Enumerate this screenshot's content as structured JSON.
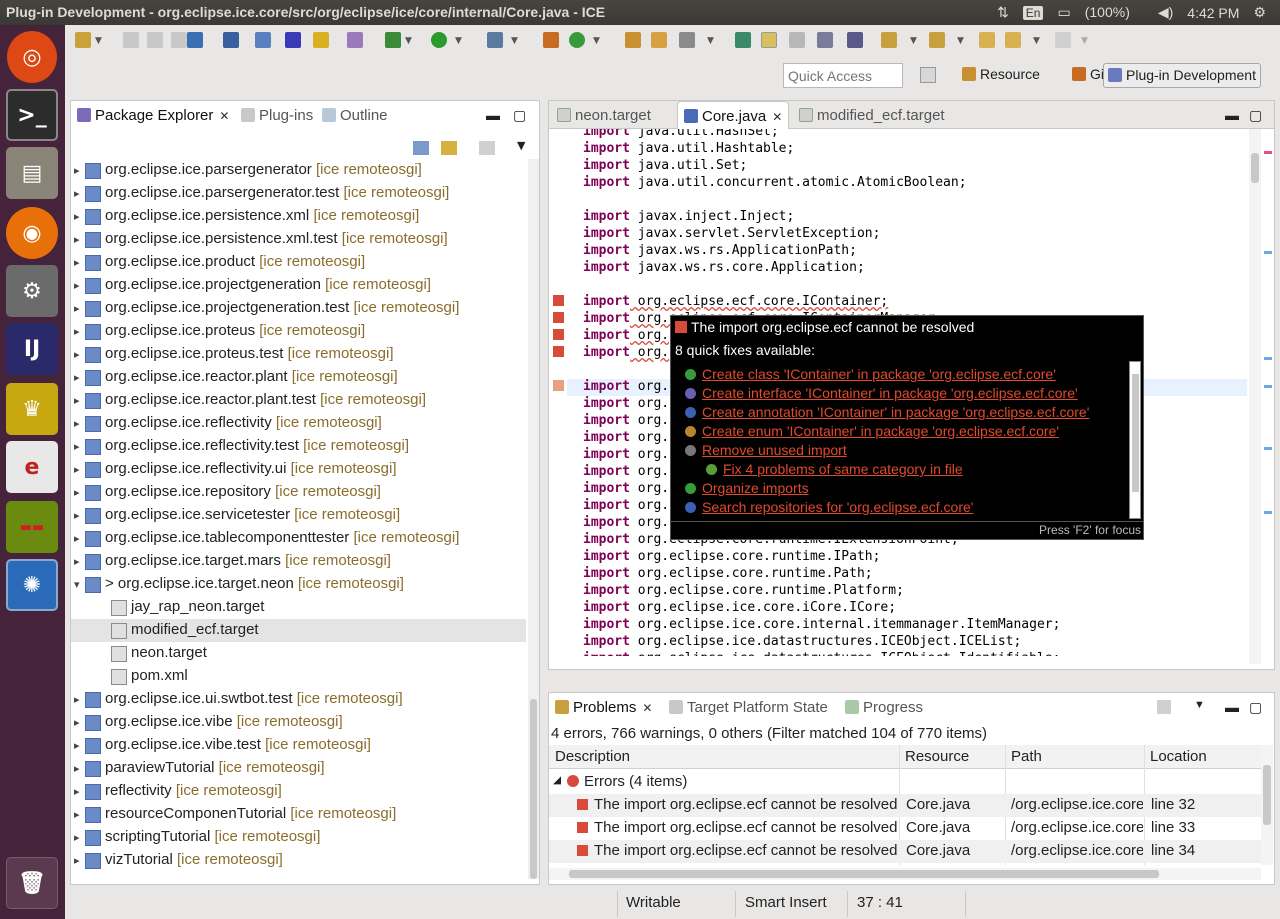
{
  "window": {
    "title": "Plug-in Development - org.eclipse.ice.core/src/org/eclipse/ice/core/internal/Core.java - ICE"
  },
  "tray": {
    "keyboard": "En",
    "battery": "(100%)",
    "clock": "4:42 PM"
  },
  "quick_access": {
    "placeholder": "Quick Access"
  },
  "perspectives": {
    "resource": "Resource",
    "git": "Git",
    "plugin": "Plug-in Development"
  },
  "package_explorer": {
    "tabs": [
      "Package Explorer",
      "Plug-ins",
      "Outline"
    ],
    "items": [
      {
        "name": "org.eclipse.ice.parsergenerator",
        "tag": "[ice remoteosgi]",
        "level": 0,
        "arrow": "▸"
      },
      {
        "name": "org.eclipse.ice.parsergenerator.test",
        "tag": "[ice remoteosgi]",
        "level": 0,
        "arrow": "▸"
      },
      {
        "name": "org.eclipse.ice.persistence.xml",
        "tag": "[ice remoteosgi]",
        "level": 0,
        "arrow": "▸"
      },
      {
        "name": "org.eclipse.ice.persistence.xml.test",
        "tag": "[ice remoteosgi]",
        "level": 0,
        "arrow": "▸"
      },
      {
        "name": "org.eclipse.ice.product",
        "tag": "[ice remoteosgi]",
        "level": 0,
        "arrow": "▸"
      },
      {
        "name": "org.eclipse.ice.projectgeneration",
        "tag": "[ice remoteosgi]",
        "level": 0,
        "arrow": "▸"
      },
      {
        "name": "org.eclipse.ice.projectgeneration.test",
        "tag": "[ice remoteosgi]",
        "level": 0,
        "arrow": "▸"
      },
      {
        "name": "org.eclipse.ice.proteus",
        "tag": "[ice remoteosgi]",
        "level": 0,
        "arrow": "▸"
      },
      {
        "name": "org.eclipse.ice.proteus.test",
        "tag": "[ice remoteosgi]",
        "level": 0,
        "arrow": "▸"
      },
      {
        "name": "org.eclipse.ice.reactor.plant",
        "tag": "[ice remoteosgi]",
        "level": 0,
        "arrow": "▸"
      },
      {
        "name": "org.eclipse.ice.reactor.plant.test",
        "tag": "[ice remoteosgi]",
        "level": 0,
        "arrow": "▸"
      },
      {
        "name": "org.eclipse.ice.reflectivity",
        "tag": "[ice remoteosgi]",
        "level": 0,
        "arrow": "▸"
      },
      {
        "name": "org.eclipse.ice.reflectivity.test",
        "tag": "[ice remoteosgi]",
        "level": 0,
        "arrow": "▸"
      },
      {
        "name": "org.eclipse.ice.reflectivity.ui",
        "tag": "[ice remoteosgi]",
        "level": 0,
        "arrow": "▸"
      },
      {
        "name": "org.eclipse.ice.repository",
        "tag": "[ice remoteosgi]",
        "level": 0,
        "arrow": "▸"
      },
      {
        "name": "org.eclipse.ice.servicetester",
        "tag": "[ice remoteosgi]",
        "level": 0,
        "arrow": "▸"
      },
      {
        "name": "org.eclipse.ice.tablecomponenttester",
        "tag": "[ice remoteosgi]",
        "level": 0,
        "arrow": "▸"
      },
      {
        "name": "org.eclipse.ice.target.mars",
        "tag": "[ice remoteosgi]",
        "level": 0,
        "arrow": "▸"
      },
      {
        "name": "> org.eclipse.ice.target.neon",
        "tag": "[ice remoteosgi]",
        "level": 0,
        "arrow": "▾"
      },
      {
        "name": "jay_rap_neon.target",
        "tag": "",
        "level": 1,
        "arrow": ""
      },
      {
        "name": "modified_ecf.target",
        "tag": "",
        "level": 1,
        "arrow": "",
        "selected": true
      },
      {
        "name": "neon.target",
        "tag": "",
        "level": 1,
        "arrow": ""
      },
      {
        "name": "pom.xml",
        "tag": "",
        "level": 1,
        "arrow": ""
      },
      {
        "name": "org.eclipse.ice.ui.swtbot.test",
        "tag": "[ice remoteosgi]",
        "level": 0,
        "arrow": "▸"
      },
      {
        "name": "org.eclipse.ice.vibe",
        "tag": "[ice remoteosgi]",
        "level": 0,
        "arrow": "▸"
      },
      {
        "name": "org.eclipse.ice.vibe.test",
        "tag": "[ice remoteosgi]",
        "level": 0,
        "arrow": "▸"
      },
      {
        "name": "paraviewTutorial",
        "tag": "[ice remoteosgi]",
        "level": 0,
        "arrow": "▸"
      },
      {
        "name": "reflectivity",
        "tag": "[ice remoteosgi]",
        "level": 0,
        "arrow": "▸"
      },
      {
        "name": "resourceComponenTutorial",
        "tag": "[ice remoteosgi]",
        "level": 0,
        "arrow": "▸"
      },
      {
        "name": "scriptingTutorial",
        "tag": "[ice remoteosgi]",
        "level": 0,
        "arrow": "▸"
      },
      {
        "name": "vizTutorial",
        "tag": "[ice remoteosgi]",
        "level": 0,
        "arrow": "▸"
      }
    ]
  },
  "editor": {
    "tabs": [
      "neon.target",
      "Core.java",
      "modified_ecf.target"
    ],
    "lines": [
      [
        "import",
        " java.util.HashSet;"
      ],
      [
        "import",
        " java.util.Hashtable;"
      ],
      [
        "import",
        " java.util.Set;"
      ],
      [
        "import",
        " java.util.concurrent.atomic.AtomicBoolean;"
      ],
      [
        "",
        ""
      ],
      [
        "import",
        " javax.inject.Inject;"
      ],
      [
        "import",
        " javax.servlet.ServletException;"
      ],
      [
        "import",
        " javax.ws.rs.ApplicationPath;"
      ],
      [
        "import",
        " javax.ws.rs.core.Application;"
      ],
      [
        "",
        ""
      ],
      [
        "import",
        " org.eclipse.ecf.core.IContainer;"
      ],
      [
        "import",
        " org.eclipse.ecf.core.IContainerManager;"
      ],
      [
        "import",
        " org."
      ],
      [
        "import",
        " org."
      ],
      [
        "",
        ""
      ],
      [
        "import",
        " org."
      ],
      [
        "import",
        " org."
      ],
      [
        "import",
        " org."
      ],
      [
        "import",
        " org."
      ],
      [
        "import",
        " org."
      ],
      [
        "import",
        " org."
      ],
      [
        "import",
        " org."
      ],
      [
        "import",
        " org."
      ],
      [
        "import",
        " org."
      ],
      [
        "import",
        " org.eclipse.core.runtime.IExtensionPoint;"
      ],
      [
        "import",
        " org.eclipse.core.runtime.IPath;"
      ],
      [
        "import",
        " org.eclipse.core.runtime.Path;"
      ],
      [
        "import",
        " org.eclipse.core.runtime.Platform;"
      ],
      [
        "import",
        " org.eclipse.ice.core.iCore.ICore;"
      ],
      [
        "import",
        " org.eclipse.ice.core.internal.itemmanager.ItemManager;"
      ],
      [
        "import",
        " org.eclipse.ice.datastructures.ICEObject.ICEList;"
      ],
      [
        "import",
        " org.eclipse.ice.datastructures.ICEObject.Identifiable;"
      ]
    ]
  },
  "hover": {
    "title": "The import org.eclipse.ecf cannot be resolved",
    "subtitle": "8 quick fixes available:",
    "fixes": [
      {
        "label": "Create class 'IContainer' in package 'org.eclipse.ecf.core'",
        "icon": "C",
        "color": "#3a9b3a"
      },
      {
        "label": "Create interface 'IContainer' in package 'org.eclipse.ecf.core'",
        "icon": "I",
        "color": "#6a5fb3"
      },
      {
        "label": "Create annotation 'IContainer' in package 'org.eclipse.ecf.core'",
        "icon": "@",
        "color": "#3a5fb3"
      },
      {
        "label": "Create enum 'IContainer' in package 'org.eclipse.ecf.core'",
        "icon": "E",
        "color": "#b8862c"
      },
      {
        "label": "Remove unused import",
        "icon": "x",
        "color": "#777777"
      },
      {
        "label": "Fix 4 problems of same category in file",
        "icon": "f",
        "color": "#5a9b3a"
      },
      {
        "label": "Organize imports",
        "icon": "o",
        "color": "#3a9b3a"
      },
      {
        "label": "Search repositories for 'org.eclipse.ecf.core'",
        "icon": "s",
        "color": "#3a5fb3"
      }
    ],
    "footer": "Press 'F2' for focus"
  },
  "problems": {
    "tabs": [
      "Problems",
      "Target Platform State",
      "Progress"
    ],
    "summary": "4 errors, 766 warnings, 0 others (Filter matched 104 of 770 items)",
    "columns": [
      "Description",
      "Resource",
      "Path",
      "Location"
    ],
    "group": "Errors (4 items)",
    "rows": [
      [
        "The import org.eclipse.ecf cannot be resolved",
        "Core.java",
        "/org.eclipse.ice.core",
        "line 32"
      ],
      [
        "The import org.eclipse.ecf cannot be resolved",
        "Core.java",
        "/org.eclipse.ice.core",
        "line 33"
      ],
      [
        "The import org.eclipse.ecf cannot be resolved",
        "Core.java",
        "/org.eclipse.ice.core",
        "line 34"
      ]
    ]
  },
  "status": {
    "writable": "Writable",
    "insert": "Smart Insert",
    "position": "37 : 41"
  },
  "colors": {
    "keyword": "#7f0055",
    "fix_link": "#e24a2c",
    "tag": "#8a6d2c",
    "launcher": "#45233a"
  }
}
